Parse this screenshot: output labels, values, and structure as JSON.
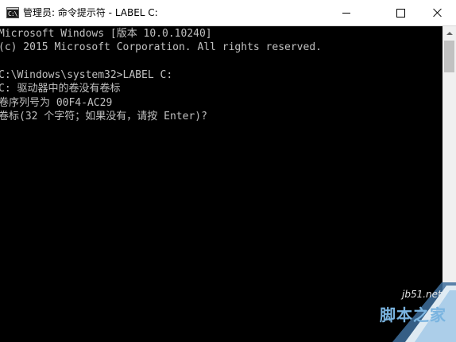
{
  "window": {
    "title": "管理员: 命令提示符 - LABEL  C:",
    "icon_text": "C:\\"
  },
  "title_buttons": {
    "minimize": "minimize-icon",
    "maximize": "maximize-icon",
    "close": "close-icon"
  },
  "console": {
    "lines": [
      "Microsoft Windows [版本 10.0.10240]",
      "(c) 2015 Microsoft Corporation. All rights reserved.",
      "",
      "C:\\Windows\\system32>LABEL C:",
      "C: 驱动器中的卷没有卷标",
      "卷序列号为 00F4-AC29",
      "卷标(32 个字符；如果没有，请按 Enter)?"
    ]
  },
  "watermark": {
    "url": "jb51.net",
    "name": "脚本之家"
  },
  "colors": {
    "console_bg": "#000000",
    "console_text": "#c0c0c0",
    "titlebar_bg": "#ffffff",
    "watermark_accent": "#7ab4e0"
  }
}
